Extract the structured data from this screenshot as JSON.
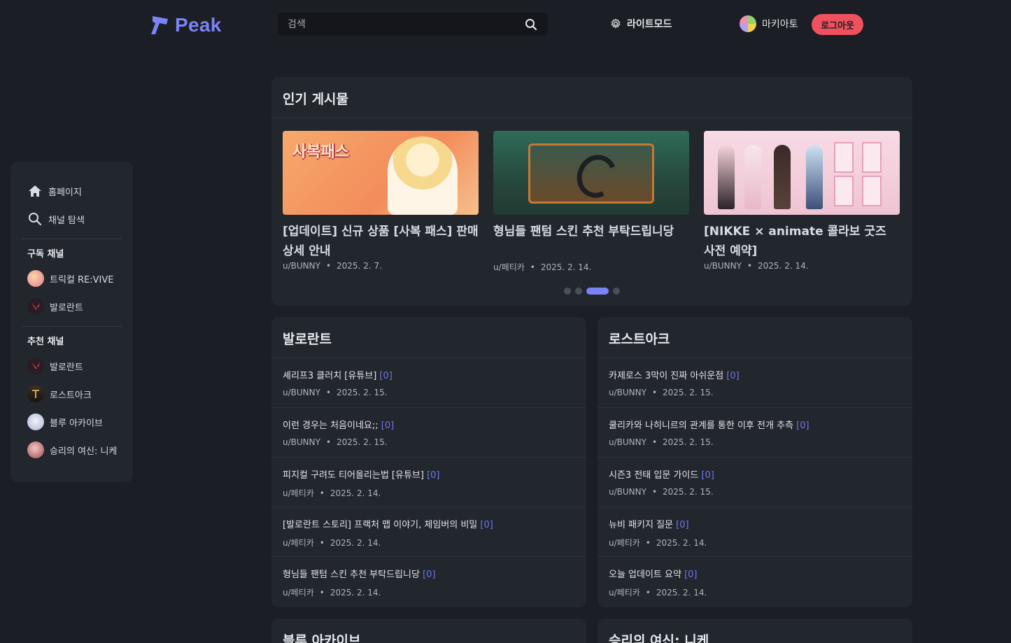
{
  "brand": {
    "name": "Peak",
    "accent": "#7b83f5"
  },
  "search": {
    "placeholder": "검색"
  },
  "header": {
    "mode_label": "라이트모드",
    "username": "마키아토",
    "logout_label": "로그아웃"
  },
  "sidebar": {
    "nav": [
      {
        "label": "홈페이지",
        "icon": "home-icon"
      },
      {
        "label": "채널 탐색",
        "icon": "search-icon"
      }
    ],
    "subscribed_title": "구독 채널",
    "subscribed": [
      {
        "label": "트릭컬 RE:VIVE"
      },
      {
        "label": "발로란트"
      }
    ],
    "recommended_title": "추천 채널",
    "recommended": [
      {
        "label": "발로란트"
      },
      {
        "label": "로스트아크"
      },
      {
        "label": "블루 아카이브"
      },
      {
        "label": "승리의 여신: 니케"
      }
    ]
  },
  "popular": {
    "title": "인기 게시물",
    "thumb1_text": "사복패스",
    "posts": [
      {
        "title": "[업데이트] 신규 상품 [사복 패스] 판매 상세 안내",
        "author": "u/BUNNY",
        "date": "2025. 2. 7."
      },
      {
        "title": "형님들 팬텀 스킨 추천 부탁드립니당",
        "author": "u/페티카",
        "date": "2025. 2. 14."
      },
      {
        "title": "[NIKKE × animate 콜라보 굿즈 사전 예약]",
        "author": "u/BUNNY",
        "date": "2025. 2. 14."
      }
    ],
    "pager_active_index": 2,
    "pager_count": 4
  },
  "valorant": {
    "title": "발로란트",
    "posts": [
      {
        "title": "셰리프3 클러치 [유튜브]",
        "count": "[0]",
        "author": "u/BUNNY",
        "date": "2025. 2. 15."
      },
      {
        "title": "이런 경우는 처음이네요;;",
        "count": "[0]",
        "author": "u/BUNNY",
        "date": "2025. 2. 15."
      },
      {
        "title": "피지컬 구려도 티어올리는법 [유튜브]",
        "count": "[0]",
        "author": "u/페티카",
        "date": "2025. 2. 14."
      },
      {
        "title": "[발로란트 스토리] 프랙처 맵 이야기, 체임버의 비밀",
        "count": "[0]",
        "author": "u/페티카",
        "date": "2025. 2. 14."
      },
      {
        "title": "형님들 팬텀 스킨 추천 부탁드립니당",
        "count": "[0]",
        "author": "u/페티카",
        "date": "2025. 2. 14."
      }
    ]
  },
  "lostark": {
    "title": "로스트아크",
    "posts": [
      {
        "title": "카제로스 3막이 진짜 아쉬운점",
        "count": "[0]",
        "author": "u/BUNNY",
        "date": "2025. 2. 15."
      },
      {
        "title": "쿨리카와 나히니르의 관계를 통한 이후 전개 추측",
        "count": "[0]",
        "author": "u/BUNNY",
        "date": "2025. 2. 15."
      },
      {
        "title": "시즌3 전태 입문 가이드",
        "count": "[0]",
        "author": "u/BUNNY",
        "date": "2025. 2. 15."
      },
      {
        "title": "뉴비 패키지 질문",
        "count": "[0]",
        "author": "u/페티카",
        "date": "2025. 2. 14."
      },
      {
        "title": "오늘 업데이트 요약",
        "count": "[0]",
        "author": "u/페티카",
        "date": "2025. 2. 14."
      }
    ]
  },
  "bluearchive": {
    "title": "블루 아카이브"
  },
  "nikke": {
    "title": "승리의 여신: 니케"
  },
  "meta_separator": "•"
}
